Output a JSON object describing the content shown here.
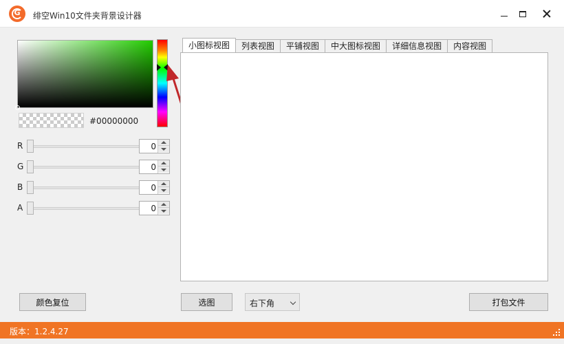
{
  "window": {
    "title": "绯空Win10文件夹背景设计器",
    "logo_letter": "G"
  },
  "color_picker": {
    "hex": "#00000000",
    "hue_color": "#22cc00",
    "sliders": [
      {
        "label": "R",
        "value": "0"
      },
      {
        "label": "G",
        "value": "0"
      },
      {
        "label": "B",
        "value": "0"
      },
      {
        "label": "A",
        "value": "0"
      }
    ]
  },
  "tabs": [
    {
      "label": "小图标视图",
      "active": true
    },
    {
      "label": "列表视图"
    },
    {
      "label": "平铺视图"
    },
    {
      "label": "中大图标视图"
    },
    {
      "label": "详细信息视图"
    },
    {
      "label": "内容视图"
    }
  ],
  "buttons": {
    "reset_color": "颜色复位",
    "select_image": "选图",
    "pack_file": "打包文件"
  },
  "position_select": {
    "value": "右下角"
  },
  "status": {
    "version": "版本：1.2.4.27"
  },
  "colors": {
    "status_bar": "#f07424",
    "logo": "#f36b2b",
    "arrow": "#c0282b"
  }
}
